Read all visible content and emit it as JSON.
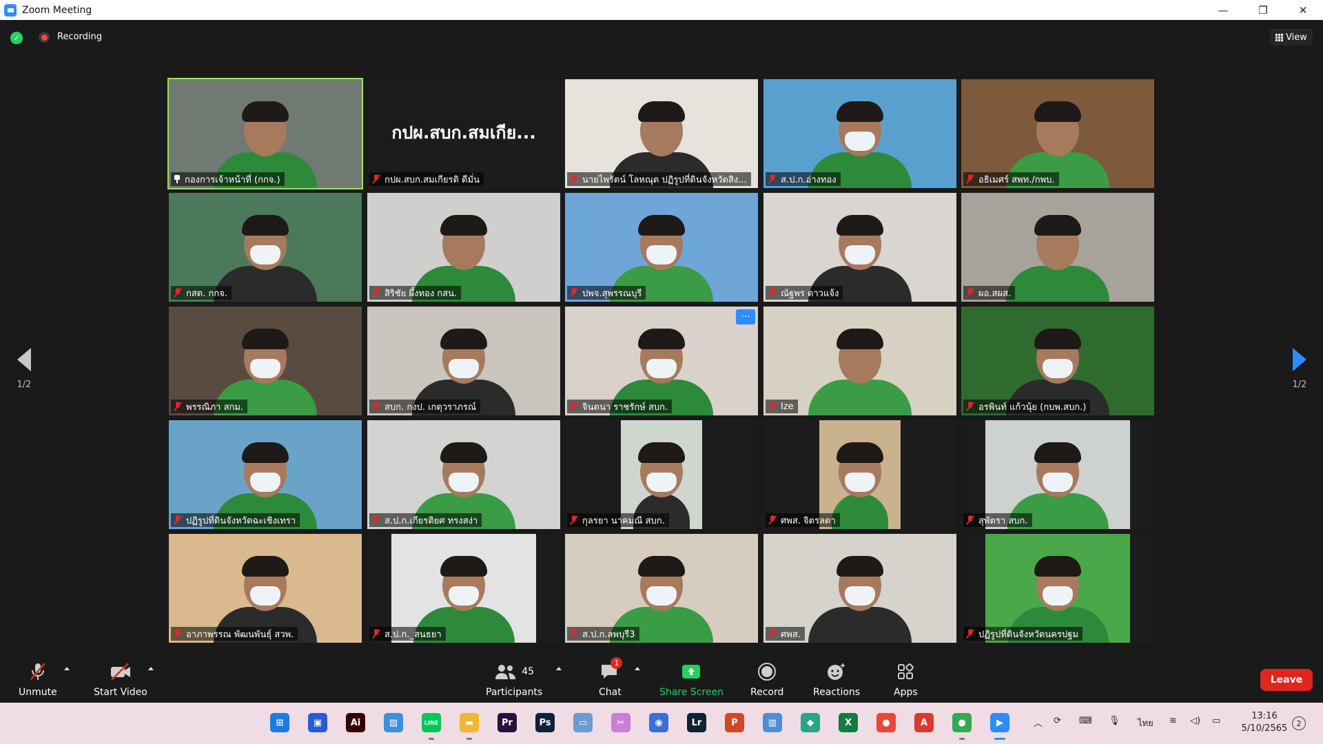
{
  "window": {
    "title": "Zoom Meeting",
    "controls": {
      "minimize": "—",
      "restore": "❐",
      "close": "✕"
    }
  },
  "topbar": {
    "recording_label": "Recording",
    "view_label": "View"
  },
  "pager": {
    "left_label": "1/2",
    "right_label": "1/2"
  },
  "participants": [
    {
      "name": "กองการเจ้าหน้าที่ (กกจ.)",
      "mic": "pinned",
      "active": true,
      "bg": "#6f7a72"
    },
    {
      "name": "กปผ.สบก.สมเกียรติ ดีมั่น",
      "mic": "muted",
      "caption": "กปผ.สบก.สมเกีย...",
      "bg": "#1c1c1c"
    },
    {
      "name": "นายไพรัตน์ โลหณุต ปฏิรูปที่ดินจังหวัดสิง...",
      "mic": "muted",
      "bg": "#e6e2dc"
    },
    {
      "name": "ส.ป.ก.อ่างทอง",
      "mic": "muted",
      "bg": "#5aa0cf"
    },
    {
      "name": "อธิเมศร์ สพท./กพบ.",
      "mic": "muted",
      "bg": "#7d5a3c"
    },
    {
      "name": "กสต. กกจ.",
      "mic": "muted",
      "bg": "#4a7a5a"
    },
    {
      "name": "สิริชัย ผึ้งทอง กสน.",
      "mic": "muted",
      "bg": "#cfcfcd"
    },
    {
      "name": "ปพจ.สุพรรณบุรี",
      "mic": "muted",
      "bg": "#6fa6d8"
    },
    {
      "name": "ณัฐพร ดาวแจ้ง",
      "mic": "muted",
      "bg": "#d9d6d2"
    },
    {
      "name": "ผอ.สผส.",
      "mic": "muted",
      "bg": "#a8a39a"
    },
    {
      "name": "พรรณิภา สกม.",
      "mic": "muted",
      "bg": "#5a4b40"
    },
    {
      "name": "สบก. กงป. เกตุวราภรณ์",
      "mic": "muted",
      "bg": "#c9c4bd"
    },
    {
      "name": "จินตนา ราชรักษ์ สบก.",
      "mic": "muted",
      "more": true,
      "bg": "#d8d2ca"
    },
    {
      "name": "Ize",
      "mic": "muted",
      "bg": "#d7d1c3"
    },
    {
      "name": "อรพินท์ แก้วนุ้ย (กบพ.สบก.)",
      "mic": "muted",
      "bg": "#2f6b2e"
    },
    {
      "name": "ปฏิรูปที่ดินจังหวัดฉะเชิงเทรา",
      "mic": "muted",
      "bg": "#6aa3c8"
    },
    {
      "name": "ส.ป.ก.เกียรติยศ ทรงสง่า",
      "mic": "muted",
      "bg": "#d3d3d1"
    },
    {
      "name": "กุลรยา นาคมณี สบก.",
      "mic": "muted",
      "bg": "#1c1c1c"
    },
    {
      "name": "ศพส. จิตรลดา",
      "mic": "muted",
      "bg": "#1c1c1c"
    },
    {
      "name": "สุพัตรา สบก.",
      "mic": "muted",
      "bg": "#1c1c1c"
    },
    {
      "name": "อาภาพรรณ พัฒนพันธุ์ สวพ.",
      "mic": "muted",
      "bg": "#d9b98d"
    },
    {
      "name": "ส.ป.ก._สนธยา",
      "mic": "muted",
      "bg": "#1c1c1c"
    },
    {
      "name": "ส.ป.ก.ลพบุรี3",
      "mic": "muted",
      "bg": "#d6ccc0"
    },
    {
      "name": "ศพส.",
      "mic": "muted",
      "bg": "#d6d2cc"
    },
    {
      "name": "ปฏิรูปที่ดินจังหวัดนครปฐม",
      "mic": "muted",
      "bg": "#1c1c1c"
    }
  ],
  "toolbar": {
    "unmute": "Unmute",
    "start_video": "Start Video",
    "participants_label": "Participants",
    "participants_count": "45",
    "chat_label": "Chat",
    "chat_badge": "1",
    "share_label": "Share Screen",
    "record_label": "Record",
    "reactions_label": "Reactions",
    "apps_label": "Apps",
    "leave_label": "Leave"
  },
  "taskbar": {
    "apps": [
      {
        "icon": "windows-start-icon",
        "glyph": "⊞",
        "color": "#1f7ae0"
      },
      {
        "icon": "microsoft-store-icon",
        "glyph": "▣",
        "color": "#2a5bd7"
      },
      {
        "icon": "illustrator-icon",
        "glyph": "Ai",
        "color": "#330000"
      },
      {
        "icon": "photos-icon",
        "glyph": "▨",
        "color": "#3c8fd8"
      },
      {
        "icon": "line-icon",
        "glyph": "LINE",
        "color": "#06c755"
      },
      {
        "icon": "file-explorer-icon",
        "glyph": "▬",
        "color": "#f2b632"
      },
      {
        "icon": "premiere-icon",
        "glyph": "Pr",
        "color": "#2a0f3d"
      },
      {
        "icon": "photoshop-icon",
        "glyph": "Ps",
        "color": "#0c2238"
      },
      {
        "icon": "remote-desktop-icon",
        "glyph": "▭",
        "color": "#6c9bd1"
      },
      {
        "icon": "snipping-tool-icon",
        "glyph": "✂",
        "color": "#c87fd6"
      },
      {
        "icon": "browser-globe-icon",
        "glyph": "◉",
        "color": "#3b6fd4"
      },
      {
        "icon": "lightroom-icon",
        "glyph": "Lr",
        "color": "#0d2233"
      },
      {
        "icon": "powerpoint-icon",
        "glyph": "P",
        "color": "#d24726"
      },
      {
        "icon": "chart-app-icon",
        "glyph": "▥",
        "color": "#4f8ed1"
      },
      {
        "icon": "notes-app-icon",
        "glyph": "◆",
        "color": "#28a687"
      },
      {
        "icon": "excel-icon",
        "glyph": "X",
        "color": "#107c41"
      },
      {
        "icon": "chrome-icon",
        "glyph": "●",
        "color": "#e8453c"
      },
      {
        "icon": "acrobat-icon",
        "glyph": "A",
        "color": "#d83b2d"
      },
      {
        "icon": "chrome-profile-icon",
        "glyph": "●",
        "color": "#34a853"
      },
      {
        "icon": "zoom-icon",
        "glyph": "▶",
        "color": "#2d8cff"
      }
    ],
    "language": "ไทย",
    "time": "13:16",
    "date": "5/10/2565",
    "notifications": "2"
  }
}
